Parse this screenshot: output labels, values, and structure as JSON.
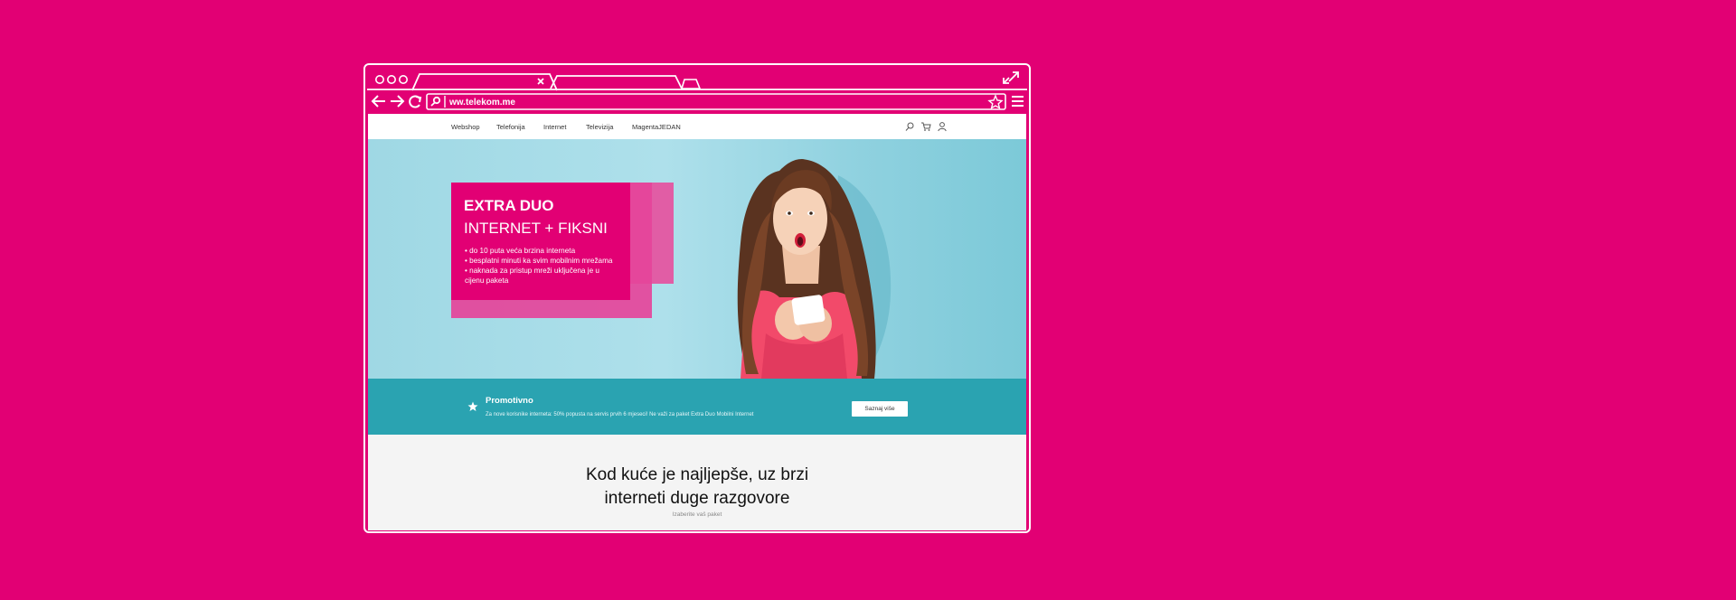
{
  "browser": {
    "address": "ww.telekom.me"
  },
  "nav": {
    "items": [
      "Webshop",
      "Telefonija",
      "Internet",
      "Televizija",
      "MagentaJEDAN"
    ]
  },
  "hero": {
    "title_bold": "EXTRA DUO",
    "title_light": "INTERNET + FIKSNI",
    "bullets": [
      "• do 10 puta veća brzina interneta",
      "• besplatni minuti ka svim mobilnim mrežama",
      "• naknada za pristup mreži uključena je u",
      "cijenu paketa"
    ]
  },
  "promo_bar": {
    "title": "Promotivno",
    "text": "Za nove korisnike interneta: 50% popusta na servis prvih 6 mjeseci! Ne važi za paket Extra Duo Mobilni Internet",
    "button": "Saznaj više"
  },
  "section": {
    "headline_line1": "Kod kuće je najljepše, uz brzi",
    "headline_line2": "interneti duge razgovore",
    "sub": "Izaberite vaš paket"
  },
  "colors": {
    "magenta": "#e20074",
    "teal": "#2aa3b1",
    "sky": "#a6dce8"
  }
}
